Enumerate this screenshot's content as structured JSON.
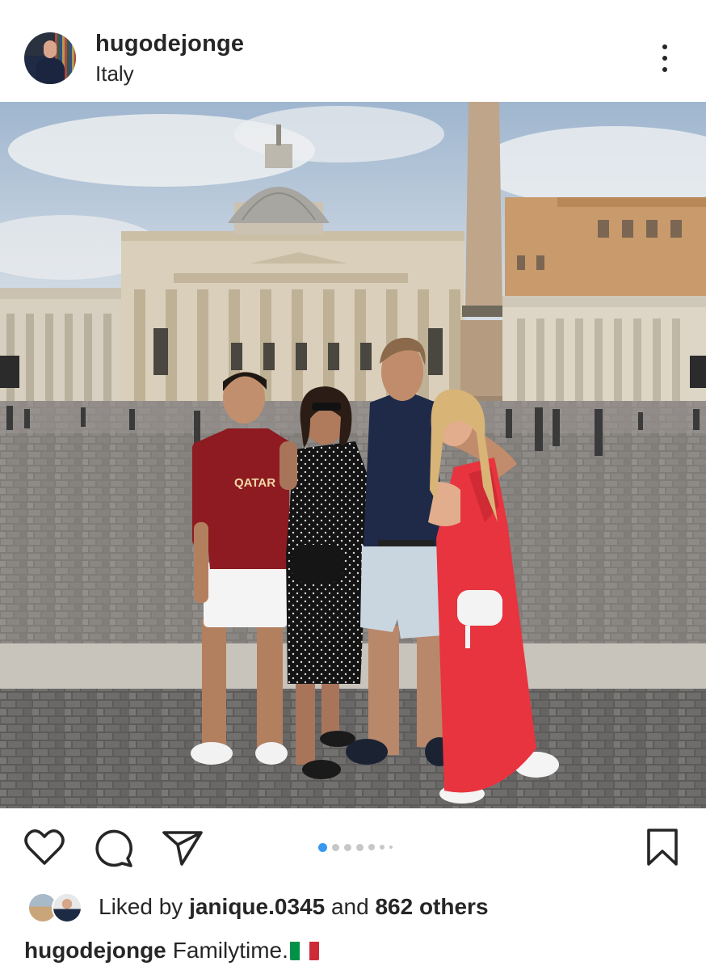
{
  "post": {
    "username": "hugodejonge",
    "location": "Italy"
  },
  "carousel": {
    "total": 7,
    "active": 1
  },
  "likes": {
    "prefix": "Liked by",
    "user": "janique.0345",
    "middle": "and",
    "others": "862 others"
  },
  "caption": {
    "username": "hugodejonge",
    "text": "Familytime.",
    "emoji": "italy-flag"
  },
  "icons": {
    "more": "more-vertical-icon",
    "like": "heart-icon",
    "comment": "comment-icon",
    "share": "send-icon",
    "save": "bookmark-icon"
  },
  "colors": {
    "text": "#262626",
    "dot_active": "#3897f0",
    "dot_inactive": "#c7c7c7"
  }
}
